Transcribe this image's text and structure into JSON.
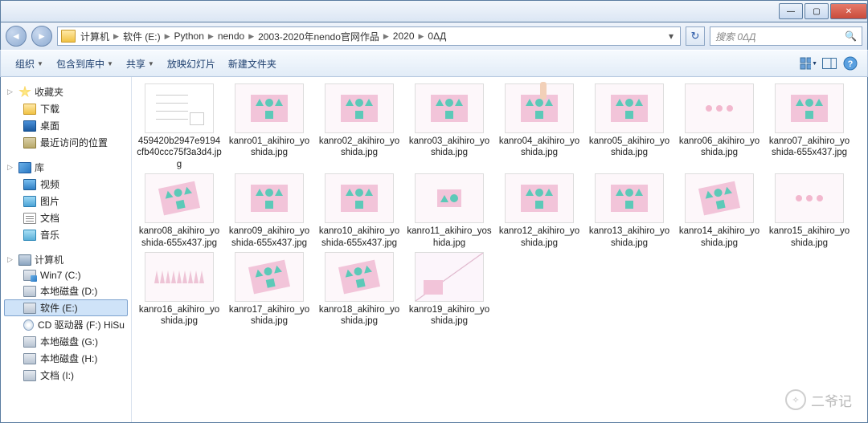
{
  "titlebar": {
    "min": "—",
    "max": "▢",
    "close": "✕"
  },
  "address": {
    "crumbs": [
      "计算机",
      "软件 (E:)",
      "Python",
      "nendo",
      "2003-2020年nendo官网作品",
      "2020",
      "0ΔД"
    ],
    "refresh": "↻"
  },
  "search": {
    "placeholder": "搜索 0ΔД",
    "icon": "🔍"
  },
  "cmdbar": {
    "organize": "组织",
    "include": "包含到库中",
    "share": "共享",
    "slideshow": "放映幻灯片",
    "newfolder": "新建文件夹"
  },
  "sidebar": {
    "fav": {
      "label": "收藏夹",
      "downloads": "下载",
      "desktop": "桌面",
      "recent": "最近访问的位置"
    },
    "lib": {
      "label": "库",
      "video": "视频",
      "pic": "图片",
      "doc": "文档",
      "music": "音乐"
    },
    "comp": {
      "label": "计算机",
      "win7": "Win7 (C:)",
      "d": "本地磁盘 (D:)",
      "e": "软件 (E:)",
      "f": "CD 驱动器 (F:) HiSu",
      "g": "本地磁盘 (G:)",
      "h": "本地磁盘 (H:)",
      "i": "文档 (I:)"
    }
  },
  "files": [
    {
      "name": "459420b2947e9194cfb40ccc75f3a3d4.jpg",
      "style": "schem"
    },
    {
      "name": "kanro01_akihiro_yoshida.jpg",
      "style": "card"
    },
    {
      "name": "kanro02_akihiro_yoshida.jpg",
      "style": "card"
    },
    {
      "name": "kanro03_akihiro_yoshida.jpg",
      "style": "card"
    },
    {
      "name": "kanro04_akihiro_yoshida.jpg",
      "style": "card-hand"
    },
    {
      "name": "kanro05_akihiro_yoshida.jpg",
      "style": "card"
    },
    {
      "name": "kanro06_akihiro_yoshida.jpg",
      "style": "dots"
    },
    {
      "name": "kanro07_akihiro_yoshida-655x437.jpg",
      "style": "card"
    },
    {
      "name": "kanro08_akihiro_yoshida-655x437.jpg",
      "style": "tilt"
    },
    {
      "name": "kanro09_akihiro_yoshida-655x437.jpg",
      "style": "card"
    },
    {
      "name": "kanro10_akihiro_yoshida-655x437.jpg",
      "style": "card"
    },
    {
      "name": "kanro11_akihiro_yoshida.jpg",
      "style": "tiny"
    },
    {
      "name": "kanro12_akihiro_yoshida.jpg",
      "style": "card-side"
    },
    {
      "name": "kanro13_akihiro_yoshida.jpg",
      "style": "card"
    },
    {
      "name": "kanro14_akihiro_yoshida.jpg",
      "style": "tilt"
    },
    {
      "name": "kanro15_akihiro_yoshida.jpg",
      "style": "dots"
    },
    {
      "name": "kanro16_akihiro_yoshida.jpg",
      "style": "spikes"
    },
    {
      "name": "kanro17_akihiro_yoshida.jpg",
      "style": "tilt"
    },
    {
      "name": "kanro18_akihiro_yoshida.jpg",
      "style": "tilt"
    },
    {
      "name": "kanro19_akihiro_yoshida.jpg",
      "style": "diag"
    }
  ],
  "watermark": "二爷记"
}
